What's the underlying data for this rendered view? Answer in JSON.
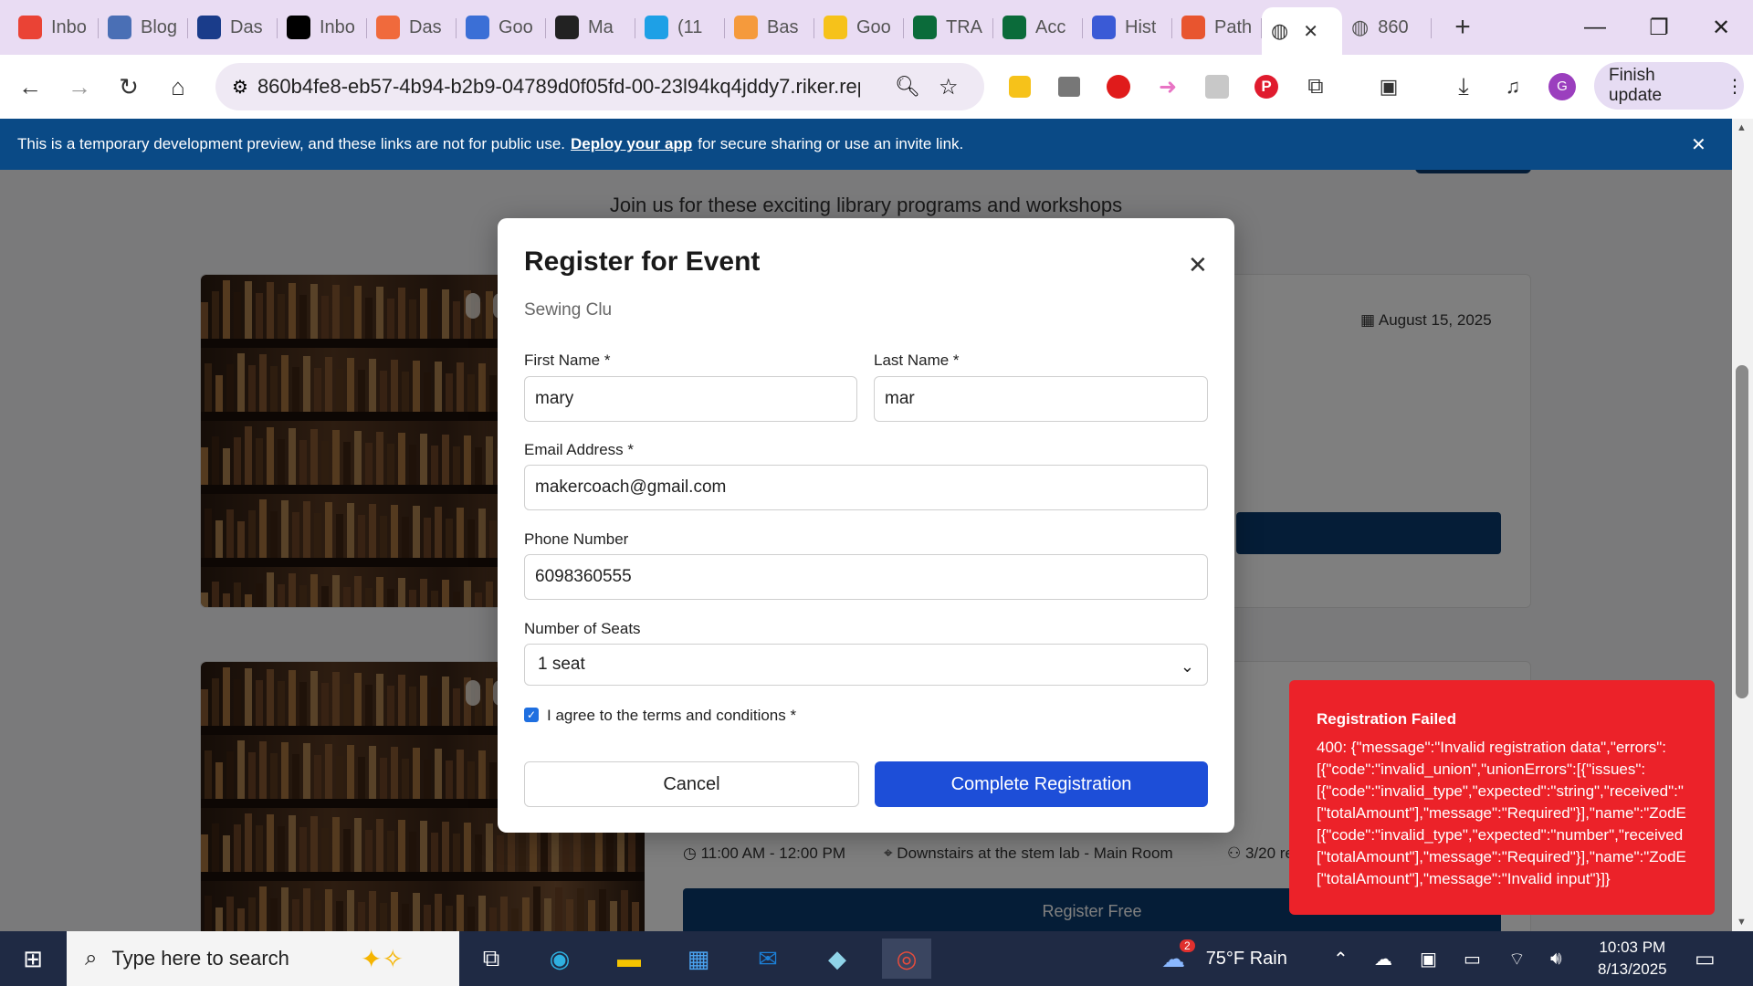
{
  "tabs": [
    {
      "label": "Inbo",
      "icon": "gmail-icon",
      "color": "#ea4335",
      "glyph": "M"
    },
    {
      "label": "Blog",
      "icon": "puzzle-icon",
      "color": "#4a6fb5",
      "glyph": "▙"
    },
    {
      "label": "Das",
      "icon": "cm-icon",
      "color": "#1a3c8a",
      "glyph": "cm"
    },
    {
      "label": "Inbo",
      "icon": "x-icon",
      "color": "#000000",
      "glyph": "X"
    },
    {
      "label": "Das",
      "icon": "flame-icon",
      "color": "#f06a3c",
      "glyph": "♨"
    },
    {
      "label": "Goo",
      "icon": "google-forms-icon",
      "color": "#3b6fd6",
      "glyph": "GE"
    },
    {
      "label": "Ma",
      "icon": "panda-icon",
      "color": "#222222",
      "glyph": "●"
    },
    {
      "label": "(11",
      "icon": "att-icon",
      "color": "#1ea0e6",
      "glyph": "◉"
    },
    {
      "label": "Bas",
      "icon": "orange-circle-icon",
      "color": "#f59a3c",
      "glyph": "●"
    },
    {
      "label": "Goo",
      "icon": "google-keep-icon",
      "color": "#f6c21a",
      "glyph": "▮"
    },
    {
      "label": "TRA",
      "icon": "terminal-icon",
      "color": "#0b6b3a",
      "glyph": "▭"
    },
    {
      "label": "Acc",
      "icon": "terminal-icon",
      "color": "#0b6b3a",
      "glyph": "▭"
    },
    {
      "label": "Hist",
      "icon": "history-icon",
      "color": "#3a5ad6",
      "glyph": "↺"
    },
    {
      "label": "Path",
      "icon": "path-icon",
      "color": "#e8552f",
      "glyph": "⁘"
    }
  ],
  "active_tab": {
    "label": "",
    "icon": "globe-icon"
  },
  "last_tab": {
    "label": "860",
    "icon": "globe-icon"
  },
  "browser": {
    "url": "860b4fe8-eb57-4b94-b2b9-04789d0f05fd-00-23l94kq4jddy7.riker.repli...",
    "finish_update": "Finish update",
    "profile_initial": "G"
  },
  "banner": {
    "text_before": "This is a temporary development preview, and these links are not for public use.",
    "link": "Deploy your app",
    "text_after": "for secure sharing or use an invite link."
  },
  "page": {
    "subtitle": "Join us for these exciting library programs and workshops",
    "card1_date": "August 15, 2025",
    "card2_time": "11:00 AM - 12:00 PM",
    "card2_location": "Downstairs at the stem lab - Main Room",
    "card2_seats": "3/20 re",
    "card2_button": "Register Free"
  },
  "modal": {
    "title": "Register for Event",
    "event_name": "Sewing Clu",
    "first_name_label": "First Name *",
    "first_name_value": "mary",
    "last_name_label": "Last Name *",
    "last_name_value": "mar",
    "email_label": "Email Address *",
    "email_value": "makercoach@gmail.com",
    "phone_label": "Phone Number",
    "phone_value": "6098360555",
    "seats_label": "Number of Seats",
    "seats_value": "1 seat",
    "terms_label": "I agree to the terms and conditions *",
    "terms_checked": true,
    "cancel": "Cancel",
    "submit": "Complete Registration"
  },
  "error_toast": {
    "title": "Registration Failed",
    "lines": [
      "400: {\"message\":\"Invalid registration data\",\"errors\":",
      "[{\"code\":\"invalid_union\",\"unionErrors\":[{\"issues\":",
      "[{\"code\":\"invalid_type\",\"expected\":\"string\",\"received\":\"",
      "[\"totalAmount\"],\"message\":\"Required\"}],\"name\":\"ZodE",
      "[{\"code\":\"invalid_type\",\"expected\":\"number\",\"received",
      "[\"totalAmount\"],\"message\":\"Required\"}],\"name\":\"ZodE",
      "[\"totalAmount\"],\"message\":\"Invalid input\"}]}"
    ]
  },
  "taskbar": {
    "search_placeholder": "Type here to search",
    "weather": "75°F  Rain",
    "weather_badge": "2",
    "time": "10:03 PM",
    "date": "8/13/2025"
  },
  "colors": {
    "primary_button": "#1d4ed8",
    "banner": "#0a4a86",
    "error": "#ec2229",
    "tabstrip": "#e9dcf3"
  }
}
